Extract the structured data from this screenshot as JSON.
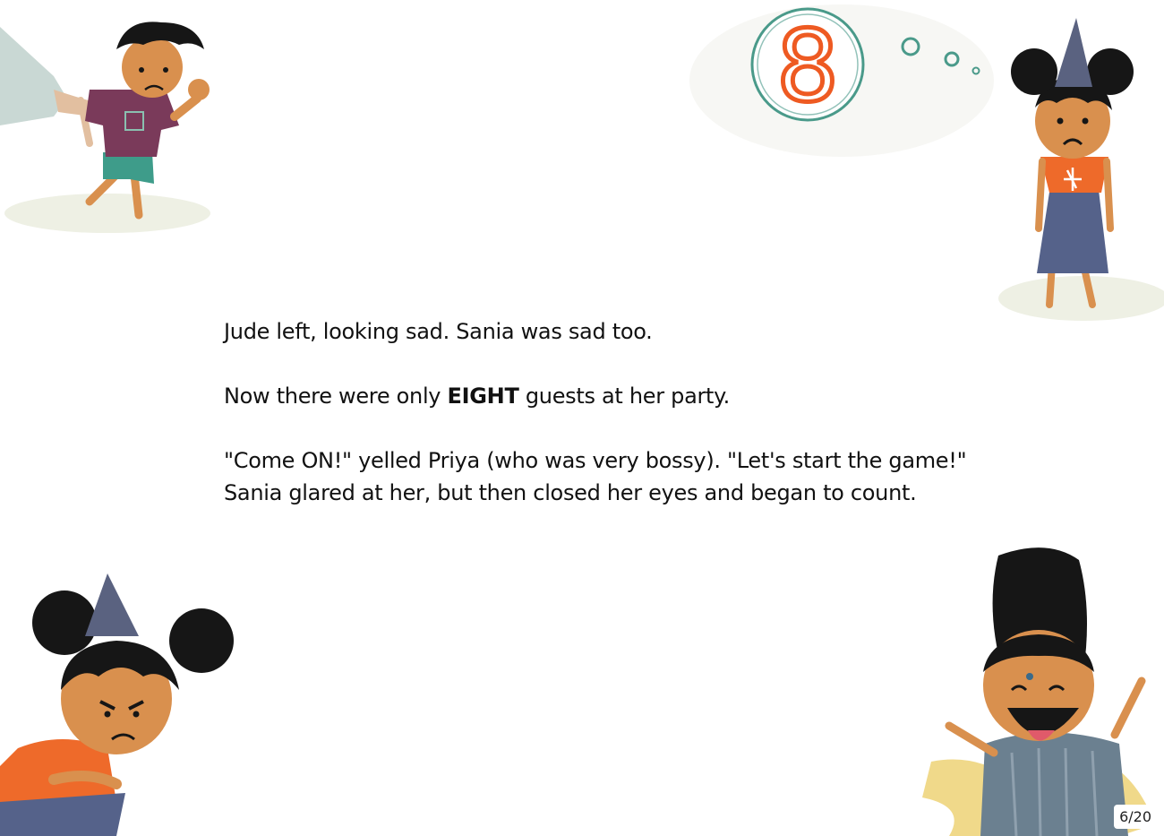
{
  "story": {
    "line1": "Jude left, looking sad. Sania was sad too.",
    "line2_pre": "Now there were only ",
    "line2_bold": "EIGHT",
    "line2_post": " guests at her party.",
    "line3": "\"Come ON!\" yelled Priya (who was very bossy). \"Let's start the game!\"",
    "line4": "Sania glared at her, but then closed her eyes and began to count."
  },
  "thought_bubble": {
    "number": "8"
  },
  "page_indicator": "6/20",
  "colors": {
    "skin": "#d9904e",
    "hair": "#161616",
    "hat": "#5a6280",
    "orange_top": "#ee6a2a",
    "blue_dress": "#55628a",
    "purple_shirt": "#7a3a5a",
    "green_shorts": "#3e9c8a",
    "bubble_ring": "#4a9a8a",
    "number_orange": "#ee5a22"
  }
}
